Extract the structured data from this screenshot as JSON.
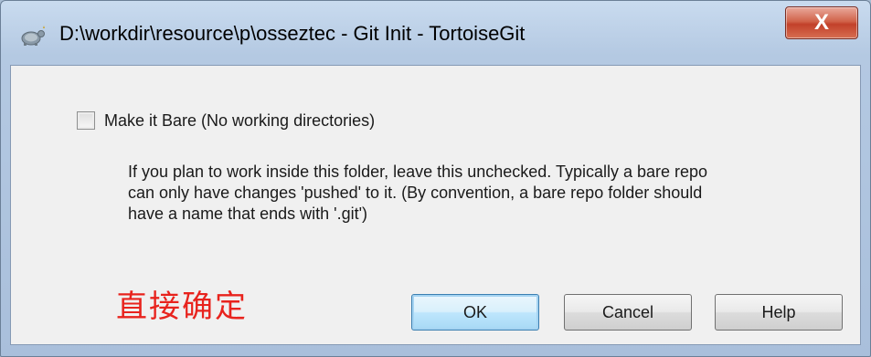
{
  "window": {
    "title": "D:\\workdir\\resource\\p\\osseztec - Git Init - TortoiseGit",
    "close_glyph": "X"
  },
  "options": {
    "bare_label": "Make it Bare (No working directories)",
    "bare_checked": false,
    "description_lines": [
      "If you plan to work inside this folder, leave this unchecked. Typically a bare repo",
      "can only have changes 'pushed' to it. (By convention, a bare repo folder should",
      "have a name that ends with '.git')"
    ]
  },
  "annotation": "直接确定",
  "buttons": {
    "ok": "OK",
    "cancel": "Cancel",
    "help": "Help"
  },
  "colors": {
    "annotation": "#e8231d",
    "default_button_border": "#3c7fb1",
    "close_button": "#c2412a"
  }
}
